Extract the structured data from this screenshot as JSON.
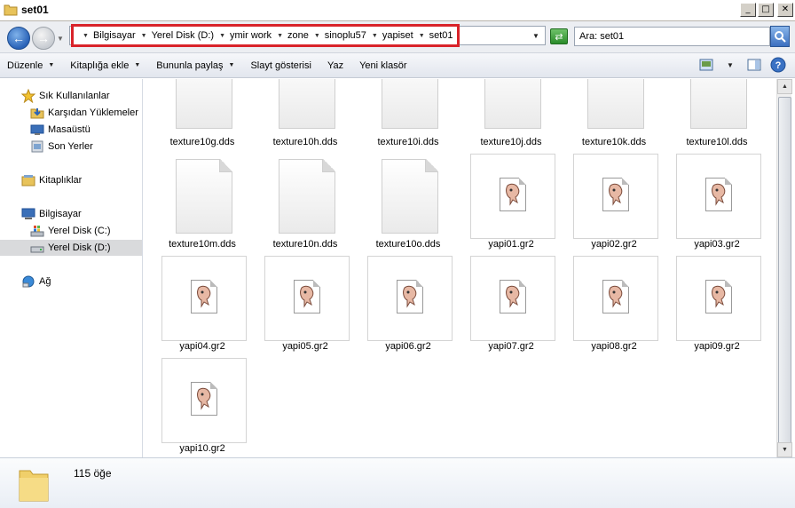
{
  "window": {
    "title": "set01"
  },
  "window_buttons": {
    "minimize": "_",
    "maximize": "□",
    "close": "✕"
  },
  "address": {
    "crumbs": [
      "Bilgisayar",
      "Yerel Disk (D:)",
      "ymir work",
      "zone",
      "sinoplu57",
      "yapiset",
      "set01"
    ]
  },
  "search": {
    "placeholder": "Ara: set01"
  },
  "toolbar": {
    "organize": "Düzenle",
    "add_to_library": "Kitaplığa ekle",
    "share_with": "Bununla paylaş",
    "slideshow": "Slayt gösterisi",
    "burn": "Yaz",
    "new_folder": "Yeni klasör"
  },
  "nav": {
    "favorites": "Sık Kullanılanlar",
    "downloads": "Karşıdan Yüklemeler",
    "desktop": "Masaüstü",
    "recent": "Son Yerler",
    "libraries": "Kitaplıklar",
    "computer": "Bilgisayar",
    "disk_c": "Yerel Disk (C:)",
    "disk_d": "Yerel Disk (D:)",
    "network": "Ağ"
  },
  "files": [
    {
      "name": "texture10g.dds",
      "kind": "dds"
    },
    {
      "name": "texture10h.dds",
      "kind": "dds"
    },
    {
      "name": "texture10i.dds",
      "kind": "dds"
    },
    {
      "name": "texture10j.dds",
      "kind": "dds"
    },
    {
      "name": "texture10k.dds",
      "kind": "dds"
    },
    {
      "name": "texture10l.dds",
      "kind": "dds"
    },
    {
      "name": "texture10m.dds",
      "kind": "dds"
    },
    {
      "name": "texture10n.dds",
      "kind": "dds"
    },
    {
      "name": "texture10o.dds",
      "kind": "dds"
    },
    {
      "name": "yapi01.gr2",
      "kind": "gr2"
    },
    {
      "name": "yapi02.gr2",
      "kind": "gr2"
    },
    {
      "name": "yapi03.gr2",
      "kind": "gr2"
    },
    {
      "name": "yapi04.gr2",
      "kind": "gr2"
    },
    {
      "name": "yapi05.gr2",
      "kind": "gr2"
    },
    {
      "name": "yapi06.gr2",
      "kind": "gr2"
    },
    {
      "name": "yapi07.gr2",
      "kind": "gr2"
    },
    {
      "name": "yapi08.gr2",
      "kind": "gr2"
    },
    {
      "name": "yapi09.gr2",
      "kind": "gr2"
    },
    {
      "name": "yapi10.gr2",
      "kind": "gr2"
    }
  ],
  "status": {
    "item_count": "115 öğe"
  },
  "colors": {
    "highlight_border": "#d9232a",
    "selected_nav": "#d9dadc"
  }
}
